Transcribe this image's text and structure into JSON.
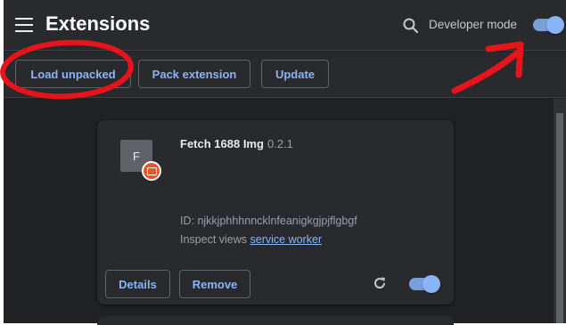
{
  "header": {
    "title": "Extensions",
    "dev_mode_label": "Developer mode",
    "dev_mode_on": true
  },
  "toolbar": {
    "load_unpacked": "Load unpacked",
    "pack_extension": "Pack extension",
    "update": "Update"
  },
  "extension": {
    "icon_letter": "F",
    "name": "Fetch 1688 Img",
    "version": "0.2.1",
    "id_text": "ID: njkkjphhhnncklnfeanigkgjpjflgbgf",
    "inspect_label": "Inspect views",
    "inspect_link": "service worker",
    "details_label": "Details",
    "remove_label": "Remove",
    "enabled": true
  },
  "colors": {
    "accent": "#8ab4f8",
    "background": "#202124",
    "surface": "#292a2d",
    "annotation": "#e8141b"
  },
  "icons": [
    "menu-icon",
    "search-icon",
    "reload-icon",
    "puzzle-badge-icon"
  ]
}
